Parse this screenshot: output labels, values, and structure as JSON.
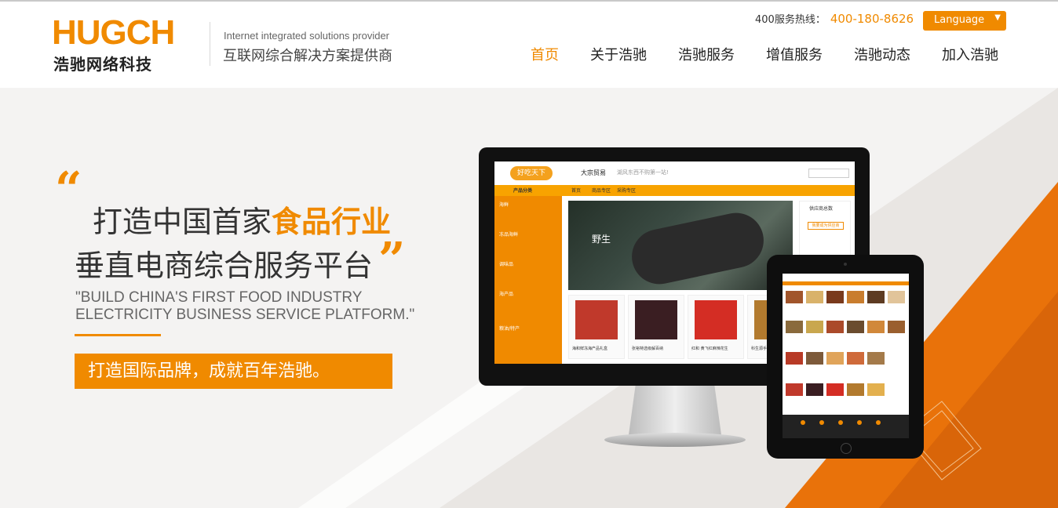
{
  "header": {
    "logo_text": "HUGCH",
    "logo_subtitle": "浩驰网络科技",
    "tagline_en": "Internet integrated solutions provider",
    "tagline_cn": "互联网综合解决方案提供商",
    "hotline_label": "400服务热线：",
    "hotline_number": "400-180-8626",
    "language_label": "Language",
    "nav": [
      {
        "label": "首页",
        "active": true
      },
      {
        "label": "关于浩驰",
        "active": false
      },
      {
        "label": "浩驰服务",
        "active": false
      },
      {
        "label": "增值服务",
        "active": false
      },
      {
        "label": "浩驰动态",
        "active": false
      },
      {
        "label": "加入浩驰",
        "active": false
      }
    ]
  },
  "hero": {
    "open_quote": "“",
    "close_quote": "”",
    "headline_prefix": "打造中国首家",
    "headline_highlight": "食品行业",
    "headline_line2": "垂直电商综合服务平台",
    "english_line1": "\"BUILD CHINA'S FIRST FOOD INDUSTRY",
    "english_line2": "ELECTRICITY BUSINESS SERVICE PLATFORM.\"",
    "banner_text": "打造国际品牌，成就百年浩驰。"
  },
  "mockup": {
    "site_logo": "好吃天下",
    "store_name": "大宗贸易",
    "slogan": "湖风东西不购第一站!",
    "sidebar_title": "产品分类",
    "categories": [
      "海鲜",
      "冻品海鲜",
      "调味品",
      "海产品",
      "粮油/特产"
    ],
    "nav_tabs": [
      "首页",
      "商品专区",
      "采购专区"
    ],
    "photo_caption": "野生",
    "right_panel_title": "供应商总数",
    "right_panel_button": "我要成为供应商",
    "products": [
      "海和鲜冻海产品礼盒",
      "张裕特选级解百纳",
      "红和 黄飞红麻辣花生",
      "科生源手抓东北"
    ]
  },
  "colors": {
    "accent": "#f08a00",
    "text_dark": "#333333",
    "text_muted": "#666666",
    "hero_bg": "#f4f3f2"
  }
}
